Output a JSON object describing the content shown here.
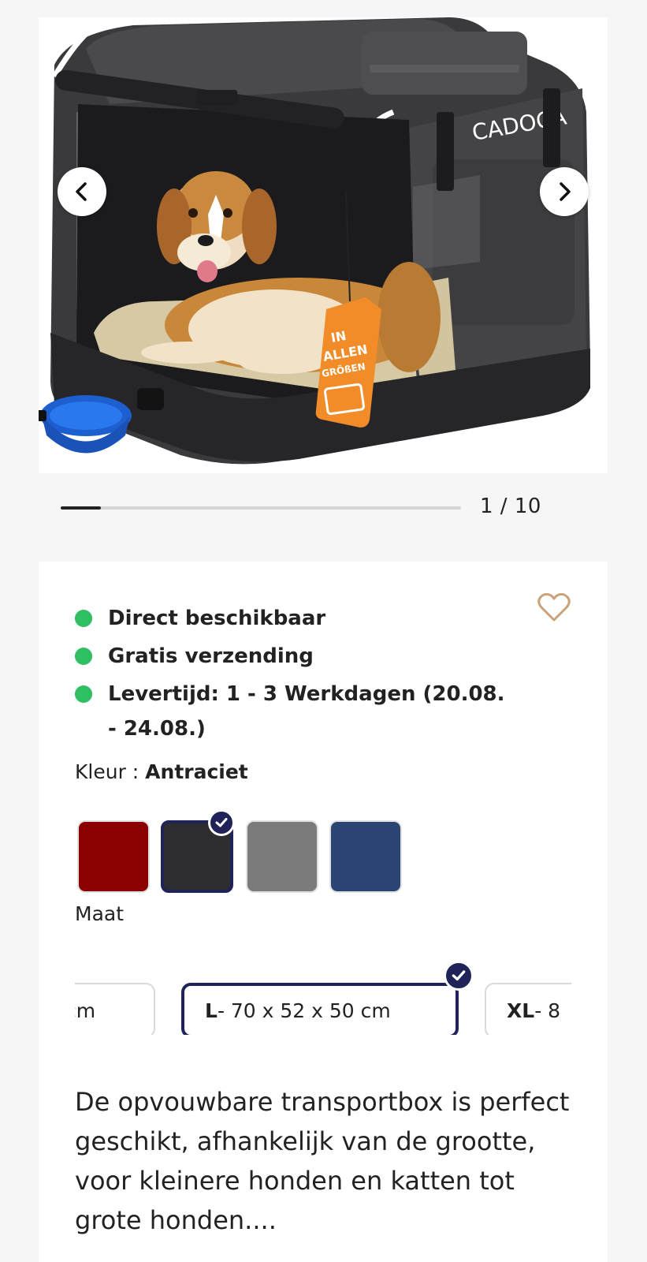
{
  "gallery": {
    "prev_icon": "chevron-left-icon",
    "next_icon": "chevron-right-icon",
    "brand_text": "CADOCA",
    "tag_text": "IN ALLEN GRÖßEN",
    "current_page": 1,
    "total_pages": 10,
    "counter": "1 / 10"
  },
  "product": {
    "usps": [
      {
        "text": "Direct beschikbaar"
      },
      {
        "text": "Gratis verzending"
      },
      {
        "text": "Levertijd: 1 - 3 Werkdagen (20.08. - 24.08.)"
      }
    ],
    "colour_label": "Kleur : ",
    "colour_value": "Antraciet",
    "colours": [
      {
        "hex": "#8b0000"
      },
      {
        "hex": "#2d2d2f",
        "selected": true
      },
      {
        "hex": "#7b7b7b"
      },
      {
        "hex": "#2c4474"
      }
    ],
    "size_label": "Maat",
    "sizes": [
      {
        "size": "",
        "dims": "cm"
      },
      {
        "size": "L",
        "dims": " - 70 x 52 x 50 cm",
        "selected": true
      },
      {
        "size": "XL",
        "dims": " - 8"
      }
    ],
    "description": "De opvouwbare transportbox is perfect geschikt, afhankelijk van de grootte, voor kleinere honden en katten tot grote honden...."
  },
  "colors": {
    "accent": "#1f2358",
    "available": "#2fbf63",
    "wishlist": "#c9a27a"
  }
}
